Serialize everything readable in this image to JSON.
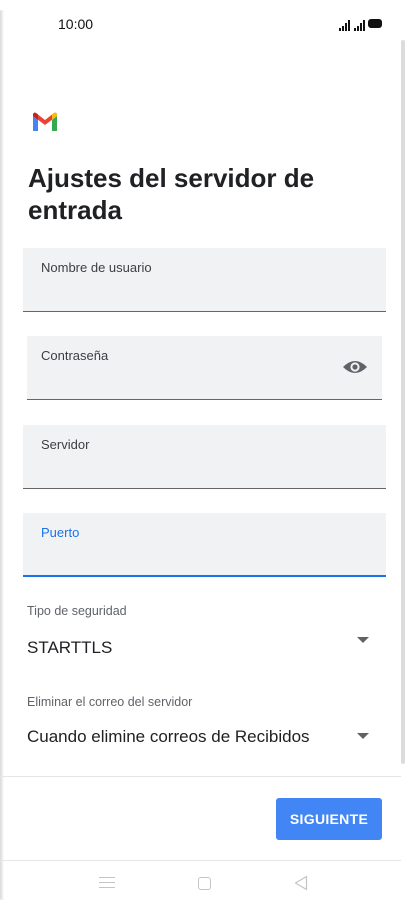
{
  "status_bar": {
    "time": "10:00",
    "icons": [
      "cell-signal-icon",
      "cell-signal-icon",
      "battery-icon"
    ]
  },
  "header": {
    "logo": "gmail-logo",
    "title": "Ajustes del servidor de entrada"
  },
  "form": {
    "username": {
      "label": "Nombre de usuario",
      "value": ""
    },
    "password": {
      "label": "Contraseña",
      "value": "",
      "icon": "eye-icon"
    },
    "server": {
      "label": "Servidor",
      "value": ""
    },
    "port": {
      "label": "Puerto",
      "value": "",
      "focused": true
    },
    "security_type": {
      "label": "Tipo de seguridad",
      "value": "STARTTLS"
    },
    "delete_from_server": {
      "label": "Eliminar el correo del servidor",
      "value": "Cuando elimine correos de Recibidos"
    }
  },
  "actions": {
    "next_label": "SIGUIENTE"
  },
  "navigation": {
    "icons": [
      "menu-icon",
      "home-icon",
      "back-icon"
    ]
  },
  "colors": {
    "accent": "#1a73e8",
    "button": "#4285f4",
    "field_bg": "#f1f2f4"
  }
}
